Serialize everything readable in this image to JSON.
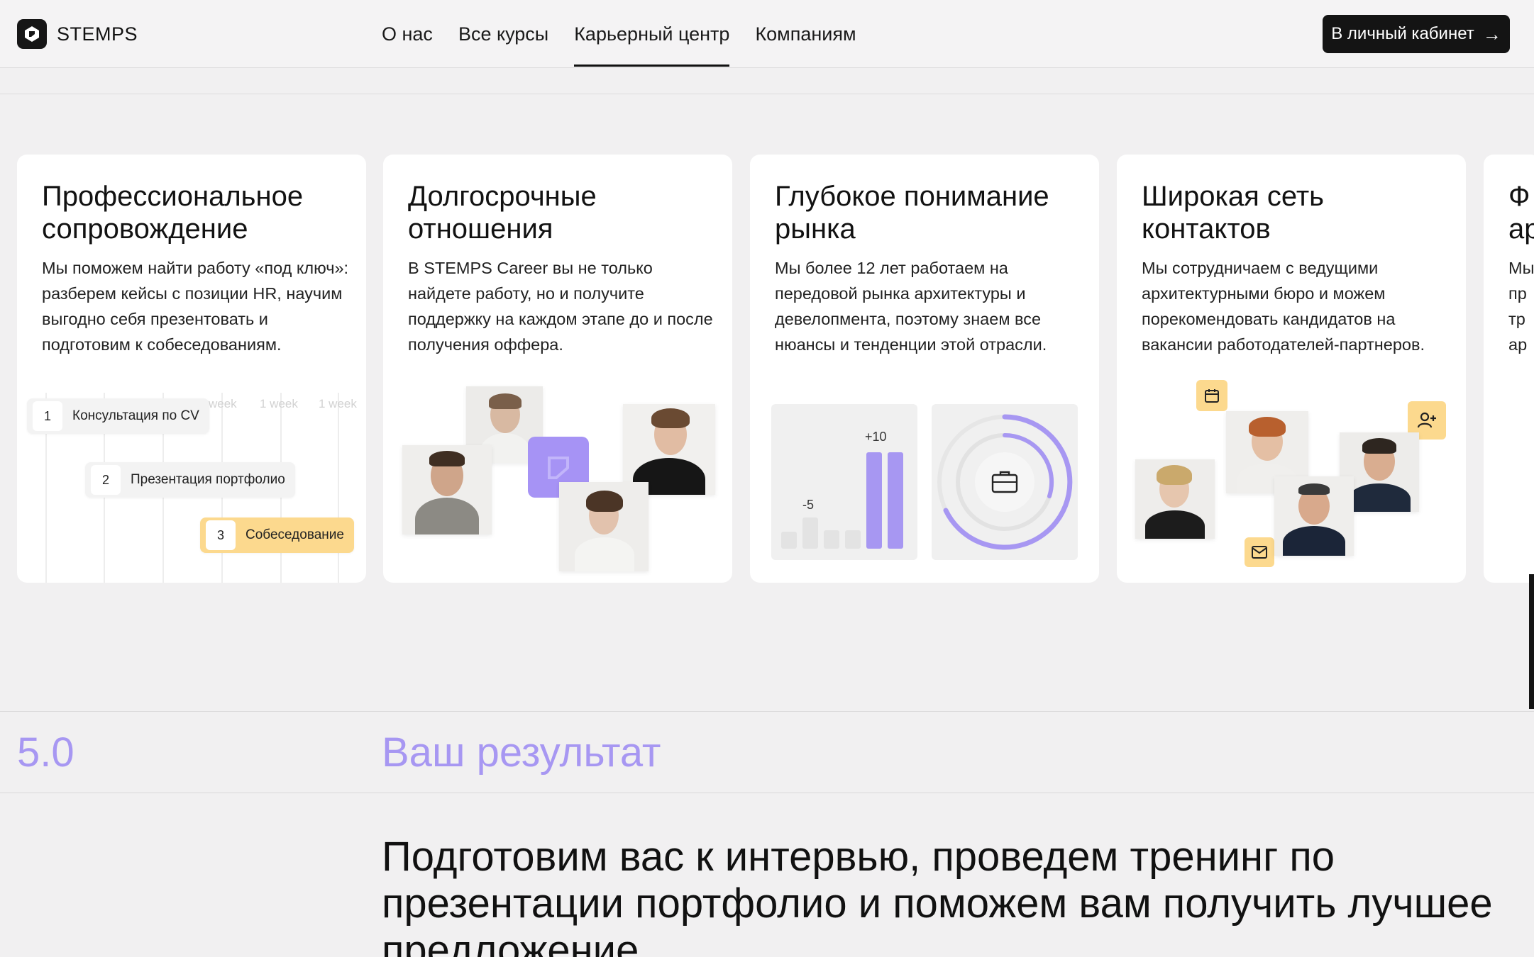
{
  "header": {
    "logo_text": "STEMPS",
    "nav": [
      "О нас",
      "Все курсы",
      "Карьерный центр",
      "Компаниям"
    ],
    "active_nav": 2,
    "cta_label": "В личный кабинет"
  },
  "cards": [
    {
      "title": "Профессиональное сопровождение",
      "text": "Мы поможем найти работу «под ключ»: разберем кейсы с позиции HR, научим выгодно себя презентовать и подготовим к собеседованиям.",
      "timeline": {
        "weeks": [
          "week",
          "1 week",
          "1 week"
        ],
        "steps": [
          {
            "num": "1",
            "label": "Консультация по CV"
          },
          {
            "num": "2",
            "label": "Презентация портфолио"
          },
          {
            "num": "3",
            "label": "Собеседование"
          }
        ]
      }
    },
    {
      "title": "Долгосрочные отношения",
      "text": "В STEMPS Career вы не только найдете работу, но и получите поддержку на каждом этапе до и после получения оффера."
    },
    {
      "title": "Глубокое понимание рынка",
      "text": "Мы более 12 лет работаем на передовой рынка архитектуры и девелопмента, поэтому знаем все нюансы и тенденции этой отрасли.",
      "chart": {
        "label_low": "-5",
        "label_high": "+10"
      }
    },
    {
      "title": "Широкая сеть контактов",
      "text": "Мы сотрудничаем с ведущими архитектурными бюро и можем порекомендовать кандидатов на вакансии работодателей-партнеров."
    },
    {
      "title_partial": "Ф\nар",
      "text_partial": "Мы\nпр\nтр\nар"
    }
  ],
  "section": {
    "number": "5.0",
    "title": "Ваш результат",
    "lead": "Подготовим вас к интервью, проведем тренинг по презентации портфолио и поможем вам получить лучшее предложение"
  },
  "colors": {
    "accent": "#a797f2",
    "yellow": "#fcd98e",
    "dark": "#141414"
  }
}
